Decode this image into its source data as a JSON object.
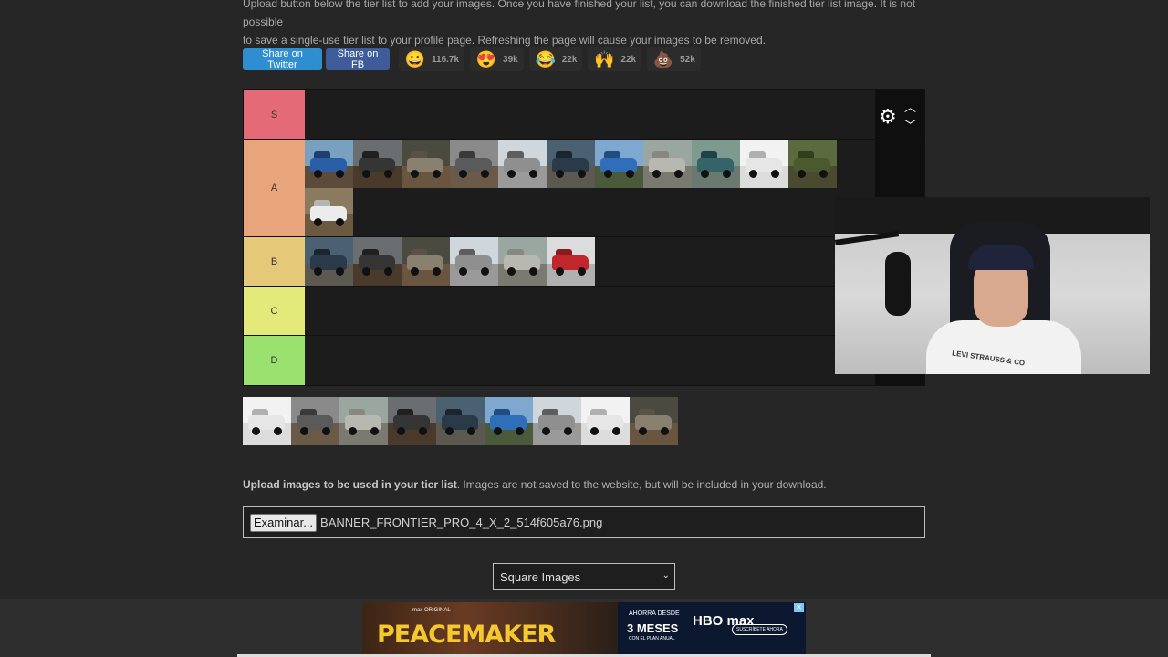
{
  "intro": {
    "line1": "Upload button below the tier list to add your images. Once you have finished your list, you can download the finished tier list image. It is not possible",
    "line2": "to save a single-use tier list to your profile page. Refreshing the page will cause your images to be removed."
  },
  "share": {
    "twitter_label": "Share on Twitter",
    "fb_label": "Share on FB",
    "reactions": [
      {
        "emoji": "😀",
        "count": "116.7k"
      },
      {
        "emoji": "😍",
        "count": "39k"
      },
      {
        "emoji": "😂",
        "count": "22k"
      },
      {
        "emoji": "🙌",
        "count": "22k"
      },
      {
        "emoji": "💩",
        "count": "52k"
      }
    ]
  },
  "tiers": [
    {
      "label": "S",
      "color": "#ff7f7f"
    },
    {
      "label": "A",
      "color": "#ffbf7f"
    },
    {
      "label": "B",
      "color": "#ffdf7f"
    },
    {
      "label": "C",
      "color": "#ffff7f"
    },
    {
      "label": "D",
      "color": "#bfff7f"
    }
  ],
  "upload": {
    "bold": "Upload images to be used in your tier list",
    "rest": ". Images are not saved to the website, but will be included in your download.",
    "button_label": "Examinar...",
    "file_name": "BANNER_FRONTIER_PRO_4_X_2_514f605a76.png"
  },
  "select": {
    "selected": "Square Images"
  },
  "ad": {
    "small": "max ORIGINAL",
    "title": "PEACEMAKER",
    "since": "AHORRA DESDE",
    "months": "3 MESES",
    "plan": "CON EL PLAN ANUAL",
    "logo": "HBO max",
    "cta": "SUSCRÍBETE AHORA"
  },
  "webcam": {
    "shirt_text": "LEVI STRAUSS & CO"
  }
}
